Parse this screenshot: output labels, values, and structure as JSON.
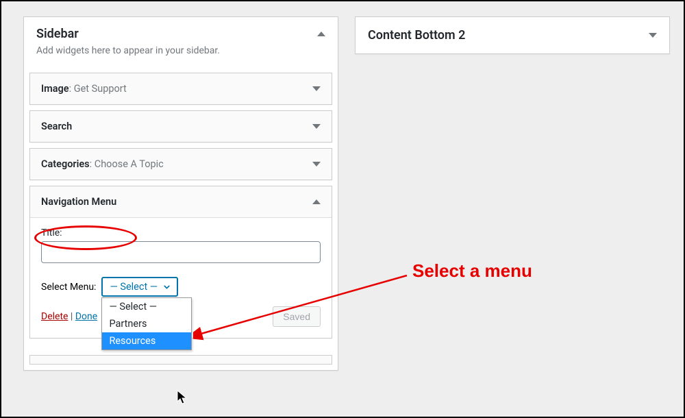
{
  "panels": {
    "sidebar": {
      "title": "Sidebar",
      "description": "Add widgets here to appear in your sidebar."
    },
    "content_bottom_2": {
      "title": "Content Bottom 2"
    }
  },
  "widgets": {
    "image": {
      "name": "Image",
      "subtitle": "Get Support"
    },
    "search": {
      "name": "Search"
    },
    "categories": {
      "name": "Categories",
      "subtitle": "Choose A Topic"
    },
    "nav_menu": {
      "name": "Navigation Menu",
      "title_label": "Title:",
      "title_value": "",
      "select_menu_label": "Select Menu:",
      "selected_display": "— Select —",
      "options": {
        "placeholder": "— Select —",
        "partners": "Partners",
        "resources": "Resources"
      },
      "delete": "Delete",
      "sep": " | ",
      "done": "Done",
      "saved": "Saved"
    }
  },
  "annotation": {
    "select_menu": "Select a menu"
  }
}
